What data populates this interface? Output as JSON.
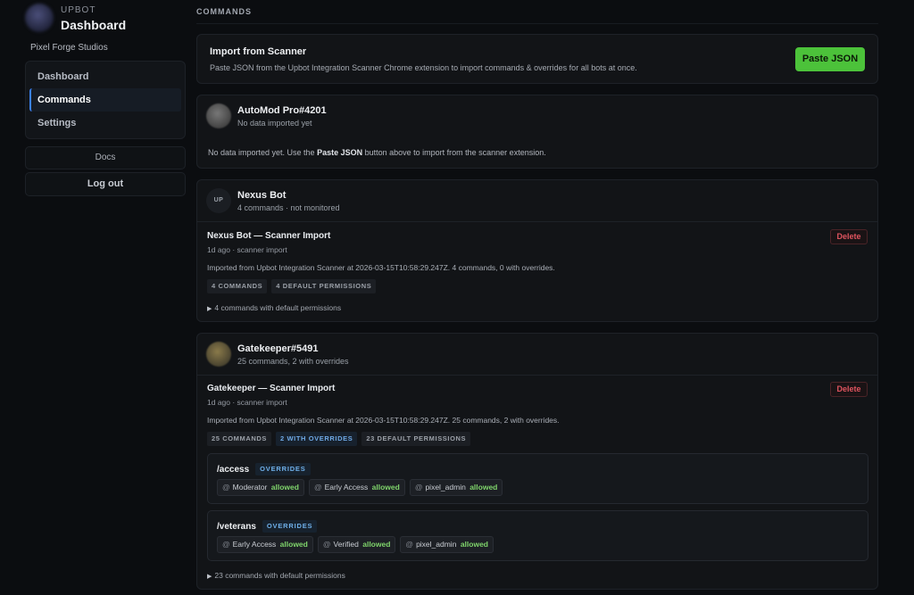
{
  "sidebar": {
    "brand_sup": "UPBOT",
    "brand_title": "Dashboard",
    "org": "Pixel Forge Studios",
    "items": [
      {
        "label": "Dashboard"
      },
      {
        "label": "Commands"
      },
      {
        "label": "Settings"
      }
    ],
    "docs": "Docs",
    "logout": "Log out"
  },
  "main": {
    "section": "COMMANDS",
    "import": {
      "title": "Import from Scanner",
      "desc": "Paste JSON from the Upbot Integration Scanner Chrome extension to import commands & overrides for all bots at once.",
      "button": "Paste JSON"
    },
    "automod": {
      "name": "AutoMod Pro#4201",
      "sub": "No data imported yet",
      "msg_before": "No data imported yet. Use the ",
      "msg_bold": "Paste JSON",
      "msg_after": " button above to import from the scanner extension."
    },
    "nexus": {
      "avatar": "UP",
      "name": "Nexus Bot",
      "sub": "4 commands · not monitored",
      "import_title": "Nexus Bot — Scanner Import",
      "import_meta": "1d ago · scanner import",
      "import_desc": "Imported from Upbot Integration Scanner at 2026-03-15T10:58:29.247Z. 4 commands, 0 with overrides.",
      "delete": "Delete",
      "tags": [
        "4 COMMANDS",
        "4 DEFAULT PERMISSIONS"
      ],
      "toggle": "4 commands with default permissions"
    },
    "gatekeeper": {
      "name": "Gatekeeper#5491",
      "sub": "25 commands, 2 with overrides",
      "import_title": "Gatekeeper — Scanner Import",
      "import_meta": "1d ago · scanner import",
      "import_desc": "Imported from Upbot Integration Scanner at 2026-03-15T10:58:29.247Z. 25 commands, 2 with overrides.",
      "delete": "Delete",
      "tags": [
        "25 COMMANDS",
        "2 WITH OVERRIDES",
        "23 DEFAULT PERMISSIONS"
      ],
      "commands": [
        {
          "name": "/access",
          "tag": "OVERRIDES",
          "perms": [
            {
              "role": "Moderator",
              "status": "allowed"
            },
            {
              "role": "Early Access",
              "status": "allowed"
            },
            {
              "role": "pixel_admin",
              "status": "allowed"
            }
          ]
        },
        {
          "name": "/veterans",
          "tag": "OVERRIDES",
          "perms": [
            {
              "role": "Early Access",
              "status": "allowed"
            },
            {
              "role": "Verified",
              "status": "allowed"
            },
            {
              "role": "pixel_admin",
              "status": "allowed"
            }
          ]
        }
      ],
      "toggle": "23 commands with default permissions"
    }
  },
  "colors": {
    "accent_green": "#4cc23a",
    "accent_blue": "#3b82f6",
    "danger": "#e0545f",
    "allowed": "#7fd46b"
  }
}
